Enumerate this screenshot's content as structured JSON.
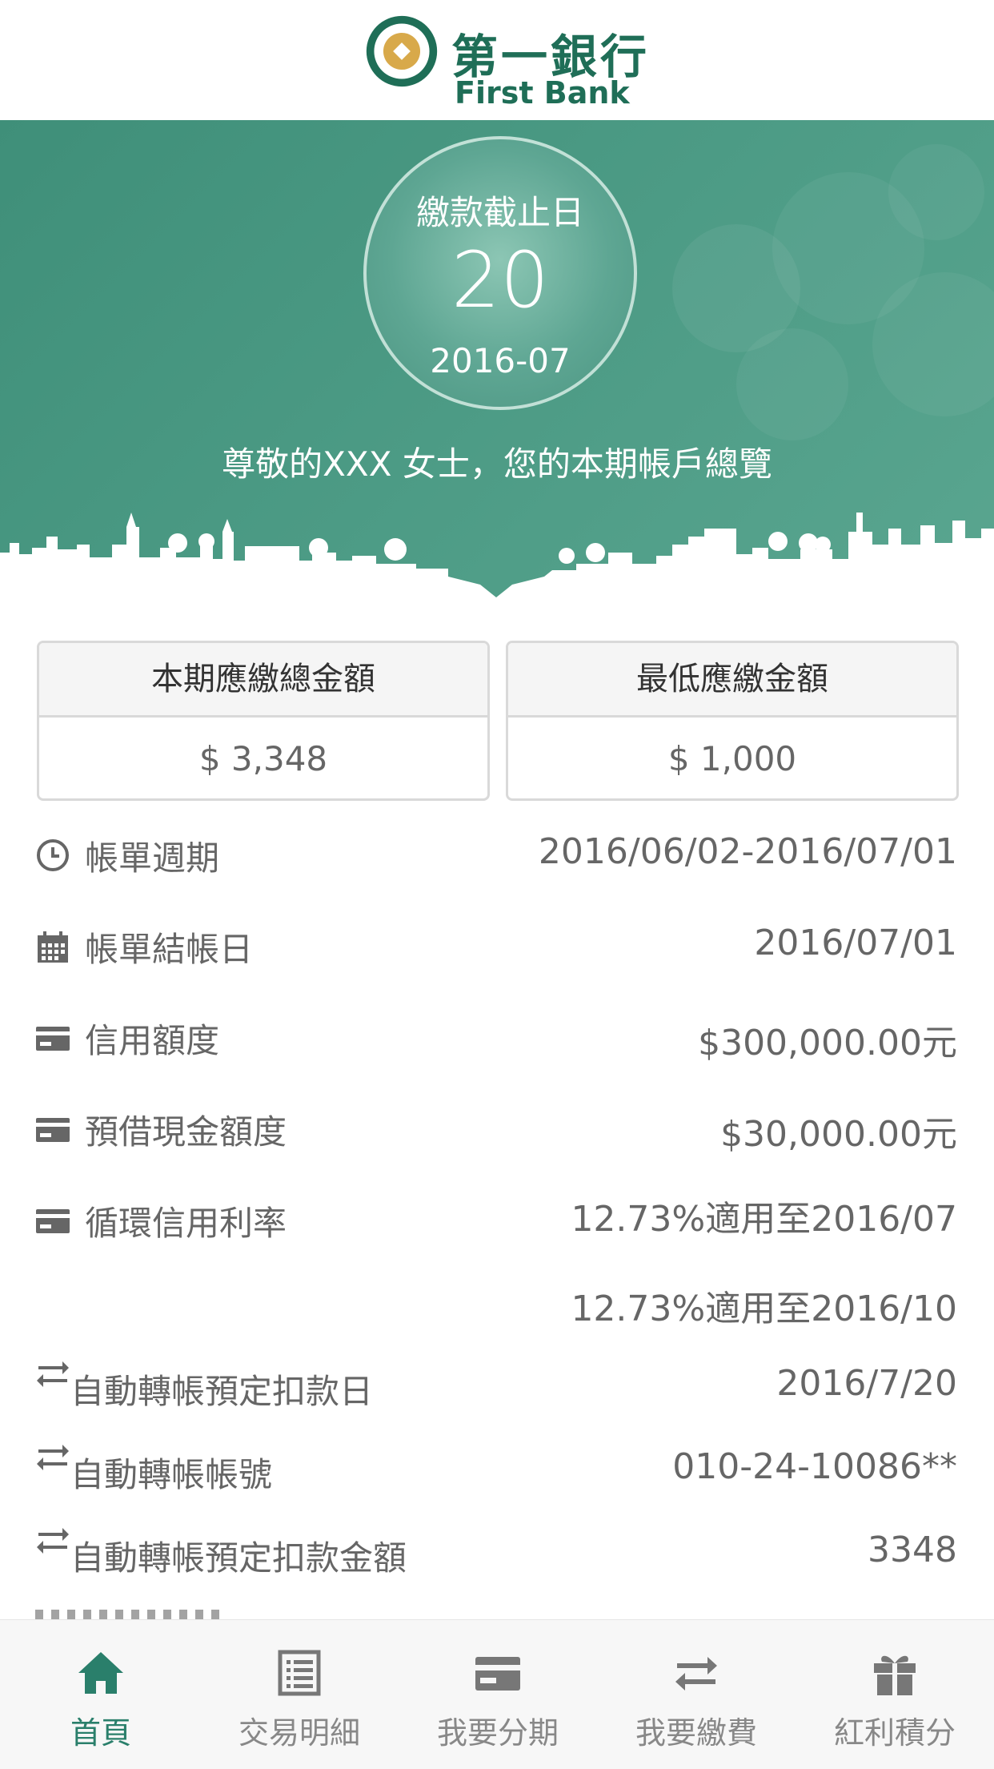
{
  "brand": {
    "name_cn": "第一銀行",
    "name_en": "First Bank"
  },
  "due": {
    "label": "繳款截止日",
    "day": "20",
    "month": "2016-07"
  },
  "greeting": "尊敬的XXX 女士，您的本期帳戶總覽",
  "amounts": {
    "total": {
      "label": "本期應繳總金額",
      "value": "$ 3,348"
    },
    "minimum": {
      "label": "最低應繳金額",
      "value": "$ 1,000"
    }
  },
  "details": [
    {
      "icon": "clock-icon",
      "label": "帳單週期",
      "value": "2016/06/02-2016/07/01"
    },
    {
      "icon": "calendar-icon",
      "label": "帳單結帳日",
      "value": "2016/07/01"
    },
    {
      "icon": "credit-card-icon",
      "label": "信用額度",
      "value": "$300,000.00元"
    },
    {
      "icon": "credit-card-icon",
      "label": "預借現金額度",
      "value": "$30,000.00元"
    },
    {
      "icon": "credit-card-icon",
      "label": "循環信用利率",
      "value": "12.73%適用至2016/07"
    },
    {
      "icon": "",
      "label": "",
      "value": "12.73%適用至2016/10"
    },
    {
      "icon": "transfer-icon",
      "label": "自動轉帳預定扣款日",
      "value": "2016/7/20"
    },
    {
      "icon": "transfer-icon",
      "label": "自動轉帳帳號",
      "value": "010-24-10086**"
    },
    {
      "icon": "transfer-icon",
      "label": "自動轉帳預定扣款金額",
      "value": "3348"
    }
  ],
  "tabs": [
    {
      "label": "首頁",
      "icon": "home-icon",
      "active": true
    },
    {
      "label": "交易明細",
      "icon": "list-icon",
      "active": false
    },
    {
      "label": "我要分期",
      "icon": "card-icon",
      "active": false
    },
    {
      "label": "我要繳費",
      "icon": "transfer-icon",
      "active": false
    },
    {
      "label": "紅利積分",
      "icon": "gift-icon",
      "active": false
    }
  ],
  "colors": {
    "primary": "#4b9a84",
    "active_tab": "#2a7f6b",
    "text": "#666666"
  }
}
